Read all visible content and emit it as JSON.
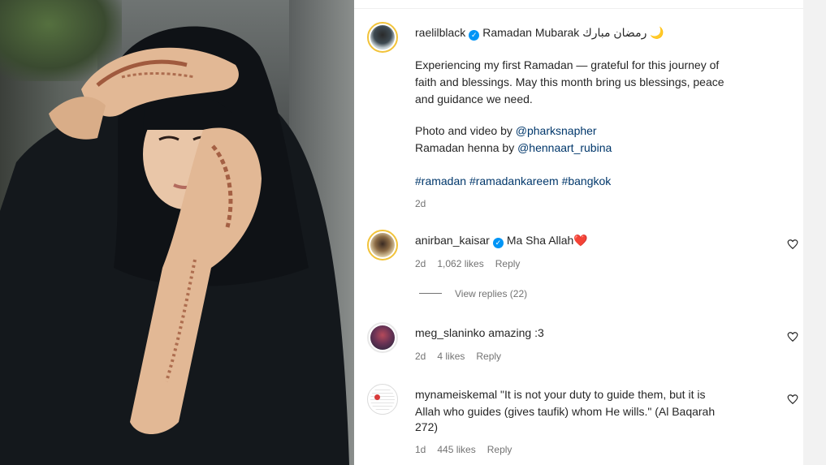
{
  "post": {
    "username": "raelilblack",
    "headline": "Ramadan Mubarak رمضان مبارك 🌙",
    "caption_lines": [
      "Experiencing my first Ramadan — grateful for this journey of",
      "faith and blessings. May this month bring us blessings, peace",
      "and guidance we need."
    ],
    "credit_photo_prefix": "Photo and video by ",
    "credit_photo_handle": "@pharksnapher",
    "credit_henna_prefix": "Ramadan henna by ",
    "credit_henna_handle": "@hennaart_rubina",
    "hashtags": [
      "#ramadan",
      "#ramadankareem",
      "#bangkok"
    ],
    "time": "2d"
  },
  "comments": [
    {
      "username": "anirban_kaisar",
      "verified": true,
      "text": "Ma Sha Allah❤️",
      "time": "2d",
      "likes": "1,062 likes",
      "reply": "Reply",
      "view_replies": "View replies (22)"
    },
    {
      "username": "meg_slaninko",
      "verified": false,
      "text": "amazing :3",
      "time": "2d",
      "likes": "4 likes",
      "reply": "Reply"
    },
    {
      "username": "mynameiskemal",
      "verified": false,
      "text_lines": [
        "\"It is not your duty to guide them, but it is",
        "Allah who guides (gives taufik) whom He wills.\" (Al Baqarah",
        "272)"
      ],
      "time": "1d",
      "likes": "445 likes",
      "reply": "Reply"
    }
  ],
  "icons": {
    "verified": "verified-badge-icon",
    "like": "heart-outline-icon"
  },
  "colors": {
    "link": "#00376b",
    "verified": "#0095f6",
    "muted": "#737373",
    "story_ring": "#f2c33a"
  }
}
